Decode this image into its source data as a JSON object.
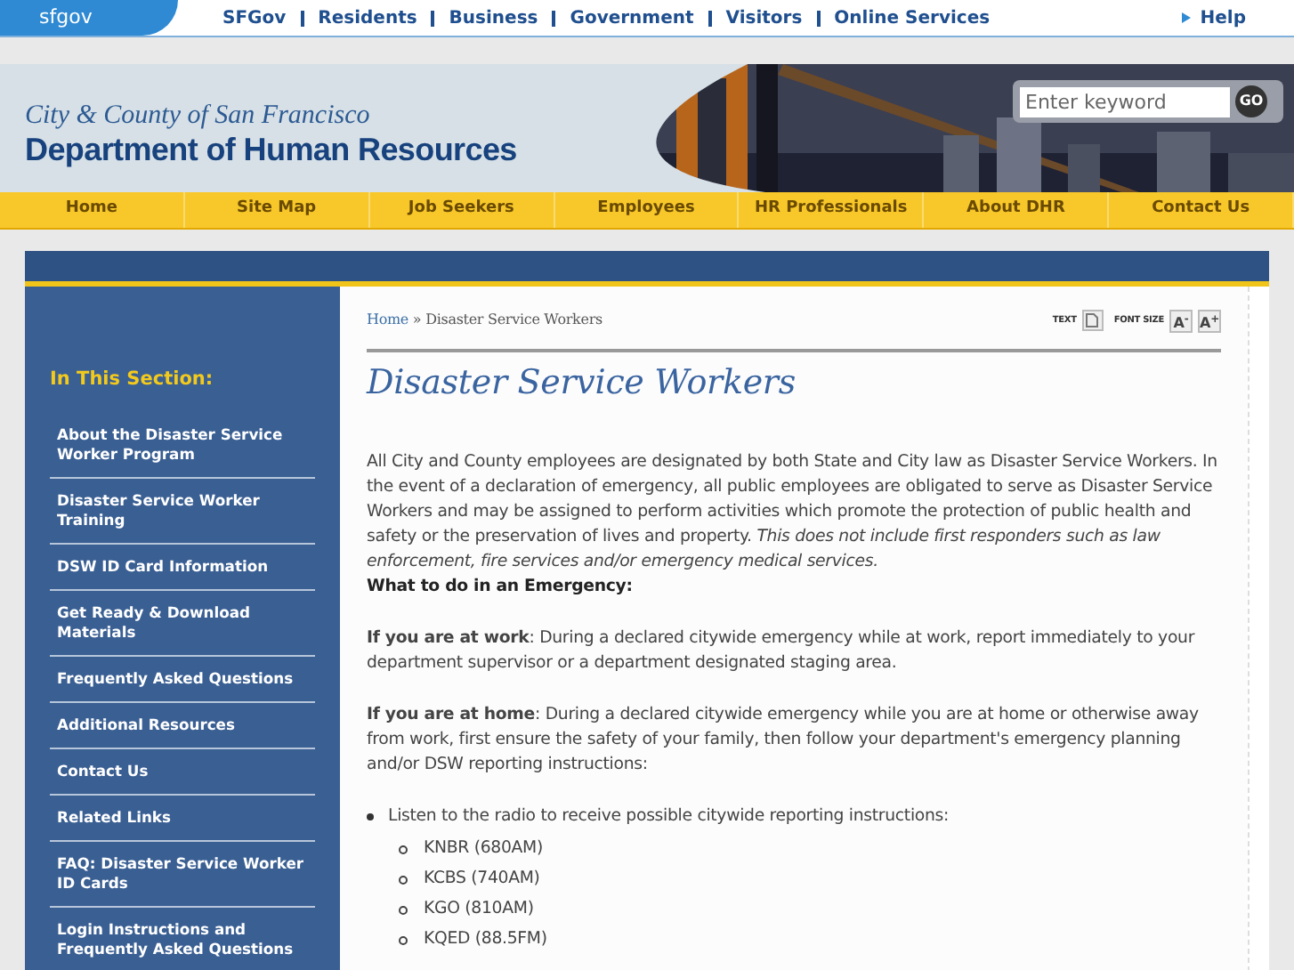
{
  "top_bar": {
    "logo": "sfgov",
    "links": [
      "SFGov",
      "Residents",
      "Business",
      "Government",
      "Visitors",
      "Online Services"
    ],
    "help": "Help"
  },
  "banner": {
    "kicker": "City & County of San Francisco",
    "title": "Department of Human Resources",
    "search": {
      "placeholder": "Enter keyword",
      "button": "GO"
    }
  },
  "nav": [
    "Home",
    "Site Map",
    "Job Seekers",
    "Employees",
    "HR Professionals",
    "About DHR",
    "Contact Us"
  ],
  "sidebar": {
    "heading": "In This Section:",
    "items": [
      "About the Disaster Service Worker Program",
      "Disaster Service Worker Training",
      "DSW ID Card Information",
      "Get Ready & Download Materials",
      "Frequently Asked Questions",
      "Additional Resources",
      "Contact Us",
      "Related Links",
      "FAQ: Disaster Service Worker ID Cards",
      "Login Instructions and Frequently Asked Questions"
    ]
  },
  "breadcrumb": {
    "link": "Home",
    "separator": "»",
    "current": "Disaster Service Workers"
  },
  "tools": {
    "text_label": "TEXT",
    "font_size_label": "FONT SIZE",
    "buttons": [
      "A$^{-}$",
      "A$^{+}$"
    ]
  },
  "title": "Disaster Service Workers",
  "body": [
    {
      "kind": "paragraph",
      "text": "All City and County employees are designated by both State and City law as  Disaster Service Workers. In the event of a declaration of emergency, all public employees are obligated to serve as Disaster Service Workers and may be assigned to perform activities which promote the protection of public health and safety or the preservation of lives and property. *This does not include first responders such as law enforcement, fire services and/or emergency medical services.*"
    },
    {
      "kind": "heading",
      "text": "What to do in an Emergency:"
    },
    {
      "kind": "paragraph",
      "text": "**If you are at work**: During a declared citywide emergency while at work, report immediately to your department supervisor or a department designated staging area."
    },
    {
      "kind": "paragraph",
      "text": "**If you are at home**: During a declared citywide emergency while you are at home or otherwise away from work, first ensure the safety of your family, then follow your department's emergency planning and/or DSW reporting instructions:"
    },
    {
      "kind": "list",
      "items": [
        {
          "text": "Listen to the radio to receive possible citywide reporting instructions:",
          "children": [
            {
              "text": "KNBR (680AM)"
            },
            {
              "text": "KCBS (740AM)"
            },
            {
              "text": "KGO (810AM)"
            },
            {
              "text": "KQED (88.5FM)"
            }
          ]
        }
      ]
    }
  ]
}
